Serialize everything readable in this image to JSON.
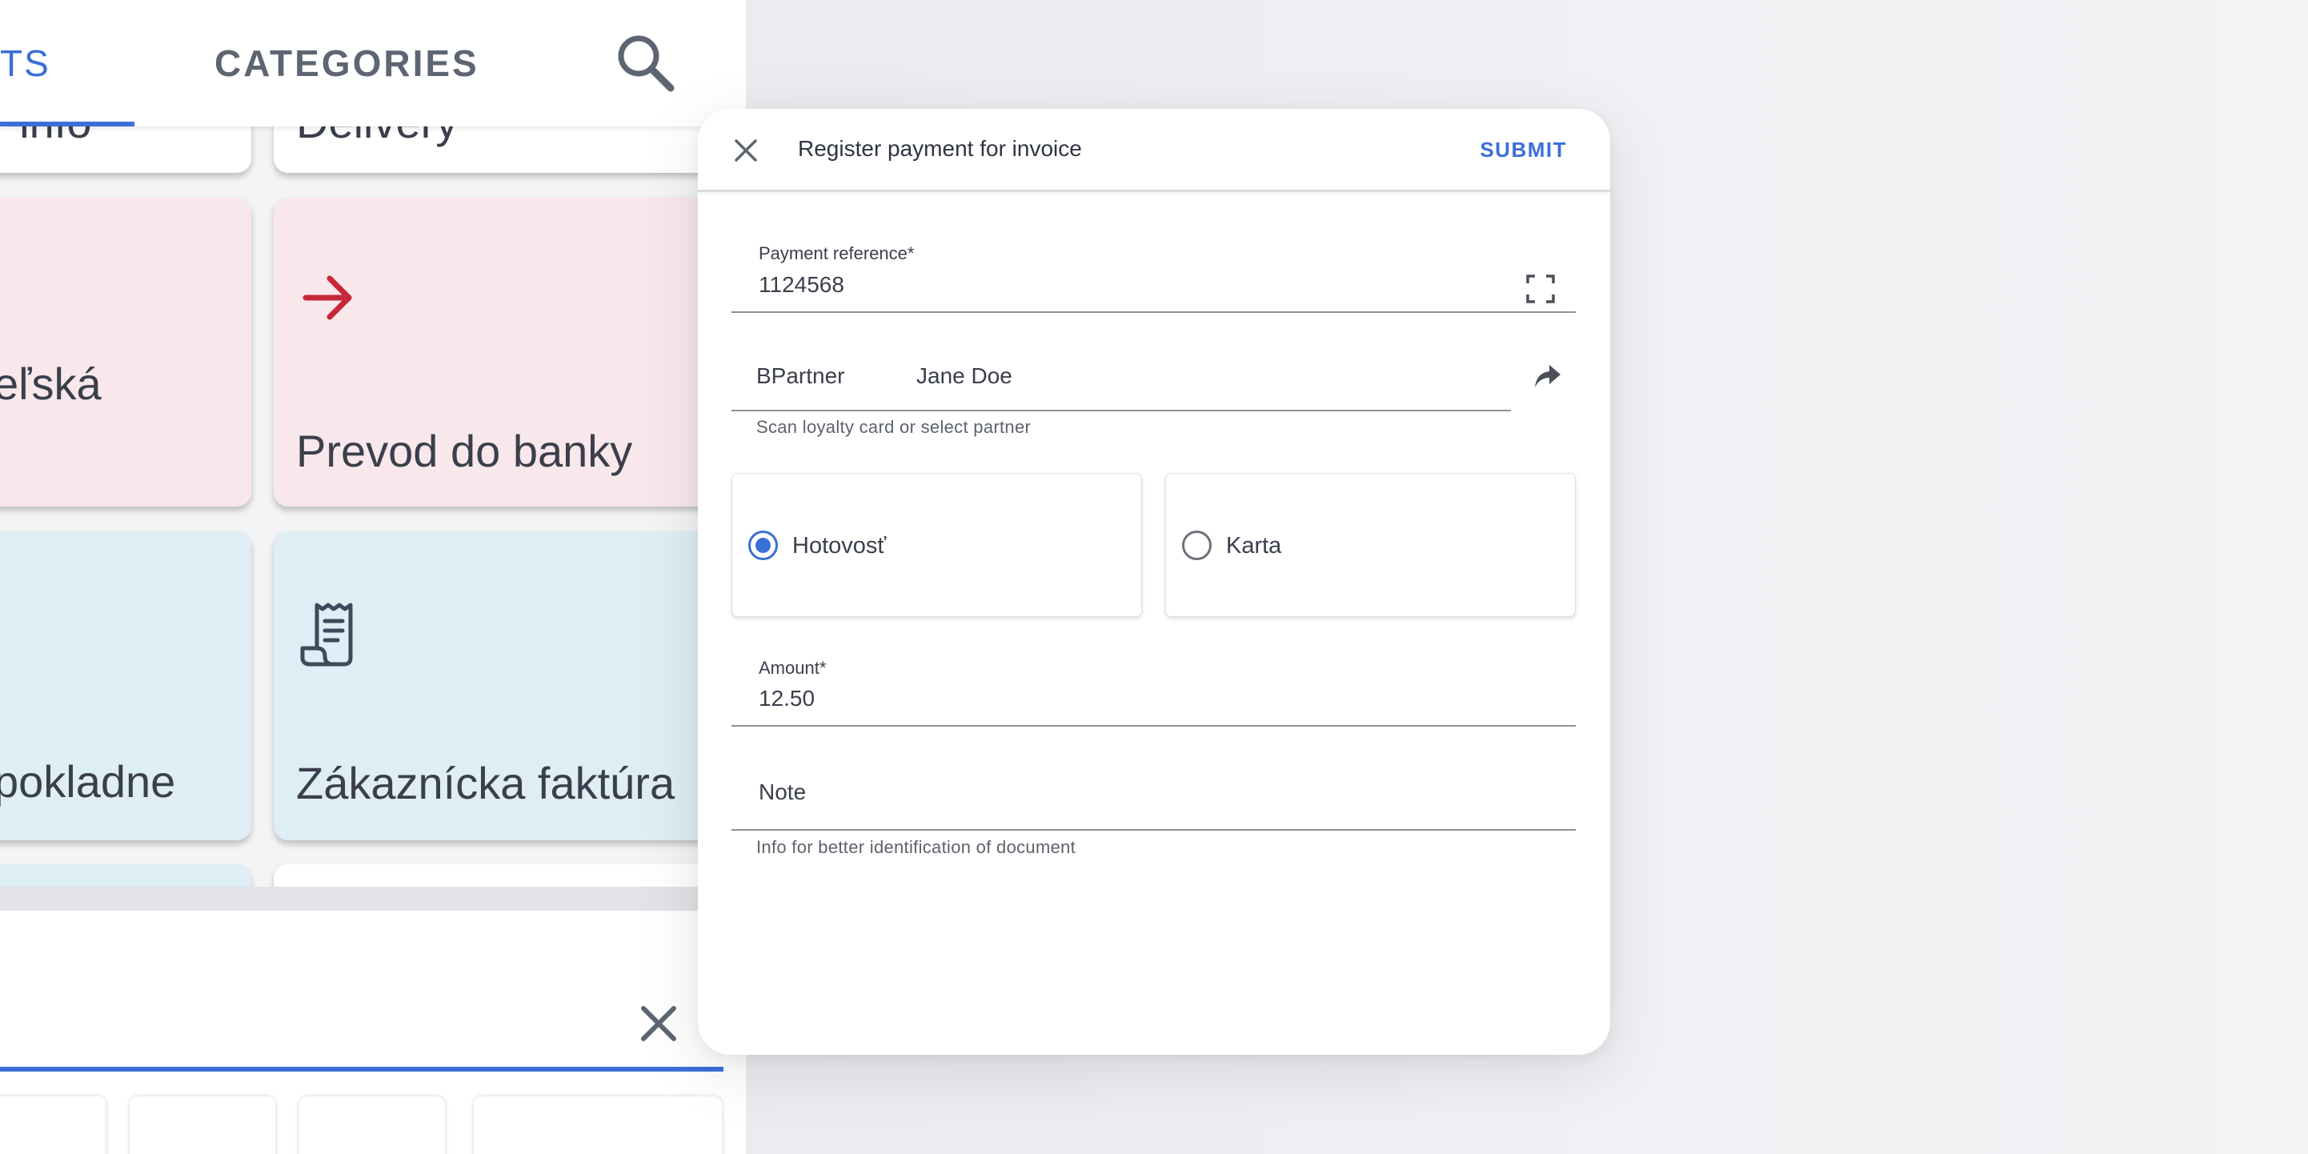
{
  "background_app": {
    "tabs": [
      {
        "label": "TS",
        "active": true
      },
      {
        "label": "CATEGORIES",
        "active": false
      }
    ],
    "tiles": [
      {
        "label": "r info",
        "color": "white"
      },
      {
        "label": "Delivery",
        "color": "white"
      },
      {
        "label": "eľská",
        "color": "pink"
      },
      {
        "label": "Prevod do banky",
        "color": "pink",
        "icon": "arrow-right-icon"
      },
      {
        "label": "pokladne",
        "color": "blue"
      },
      {
        "label": "Zákaznícka faktúra",
        "color": "blue",
        "icon": "receipt-icon"
      }
    ]
  },
  "dialog": {
    "title": "Register payment for invoice",
    "submit_label": "SUBMIT",
    "payment_reference": {
      "label": "Payment reference*",
      "value": "1124568"
    },
    "bpartner": {
      "label": "BPartner",
      "value": "Jane Doe",
      "helper": "Scan loyalty card or select partner"
    },
    "payment_methods": [
      {
        "label": "Hotovosť",
        "selected": true
      },
      {
        "label": "Karta",
        "selected": false
      }
    ],
    "amount": {
      "label": "Amount*",
      "value": "12.50"
    },
    "note": {
      "placeholder": "Note",
      "helper": "Info for better identification of document"
    }
  },
  "colors": {
    "accent": "#3a6fd6",
    "arrow_red": "#c8273b",
    "tile_pink": "#f8e7eb",
    "tile_blue": "#dfedf4"
  }
}
